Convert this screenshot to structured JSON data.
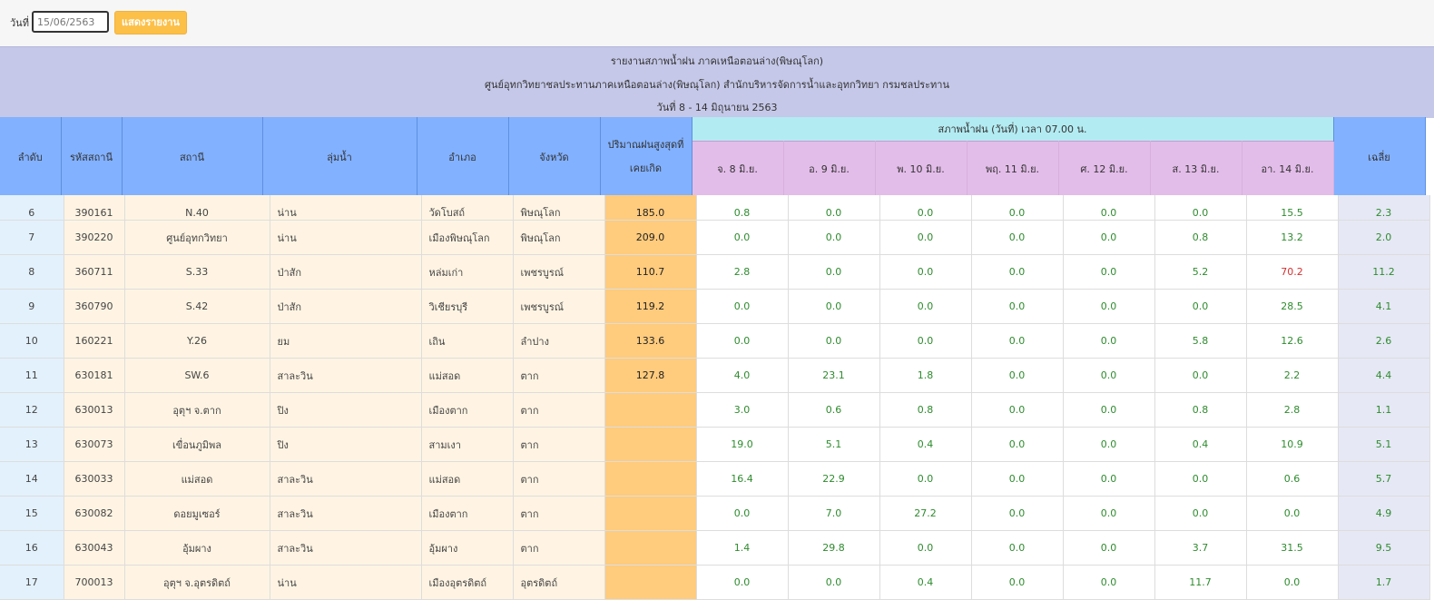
{
  "filter": {
    "date_label": "วันที่",
    "date_value": "15/06/2563",
    "show_button": "แสดงรายงาน"
  },
  "report": {
    "title1": "รายงานสภาพน้ำฝน ภาคเหนือตอนล่าง(พิษณุโลก)",
    "title2": "ศูนย์อุทกวิทยาชลประทานภาคเหนือตอนล่าง(พิษณุโลก) สำนักบริหารจัดการน้ำและอุทกวิทยา กรมชลประทาน",
    "title3": "วันที่ 8 - 14 มิถุนายน 2563"
  },
  "headers": {
    "seq": "ลำดับ",
    "code": "รหัสสถานี",
    "station": "สถานี",
    "basin": "ลุ่มน้ำ",
    "district": "อำเภอ",
    "province": "จังหวัด",
    "max_line1": "ปริมาณฝนสูงสุดที่",
    "max_line2": "เคยเกิด",
    "group": "สภาพน้ำฝน (วันที่) เวลา 07.00 น.",
    "days": [
      "จ. 8 มิ.ย.",
      "อ. 9 มิ.ย.",
      "พ. 10 มิ.ย.",
      "พฤ. 11 มิ.ย.",
      "ศ. 12 มิ.ย.",
      "ส. 13 มิ.ย.",
      "อา. 14 มิ.ย."
    ],
    "avg": "เฉลี่ย"
  },
  "rows": [
    {
      "seq": "6",
      "code": "390161",
      "station": "N.40",
      "basin": "น่าน",
      "district": "วัดโบสถ์",
      "province": "พิษณุโลก",
      "max": "185.0",
      "vals": [
        "0.8",
        "0.0",
        "0.0",
        "0.0",
        "0.0",
        "0.0",
        "15.5"
      ],
      "avg": "2.3",
      "high": -1
    },
    {
      "seq": "7",
      "code": "390220",
      "station": "ศูนย์อุทกวิทยา",
      "basin": "น่าน",
      "district": "เมืองพิษณุโลก",
      "province": "พิษณุโลก",
      "max": "209.0",
      "vals": [
        "0.0",
        "0.0",
        "0.0",
        "0.0",
        "0.0",
        "0.8",
        "13.2"
      ],
      "avg": "2.0",
      "high": -1
    },
    {
      "seq": "8",
      "code": "360711",
      "station": "S.33",
      "basin": "ป่าสัก",
      "district": "หล่มเก่า",
      "province": "เพชรบูรณ์",
      "max": "110.7",
      "vals": [
        "2.8",
        "0.0",
        "0.0",
        "0.0",
        "0.0",
        "5.2",
        "70.2"
      ],
      "avg": "11.2",
      "high": 6
    },
    {
      "seq": "9",
      "code": "360790",
      "station": "S.42",
      "basin": "ป่าสัก",
      "district": "วิเชียรบุรี",
      "province": "เพชรบูรณ์",
      "max": "119.2",
      "vals": [
        "0.0",
        "0.0",
        "0.0",
        "0.0",
        "0.0",
        "0.0",
        "28.5"
      ],
      "avg": "4.1",
      "high": -1
    },
    {
      "seq": "10",
      "code": "160221",
      "station": "Y.26",
      "basin": "ยม",
      "district": "เถิน",
      "province": "ลำปาง",
      "max": "133.6",
      "vals": [
        "0.0",
        "0.0",
        "0.0",
        "0.0",
        "0.0",
        "5.8",
        "12.6"
      ],
      "avg": "2.6",
      "high": -1
    },
    {
      "seq": "11",
      "code": "630181",
      "station": "SW.6",
      "basin": "สาละวิน",
      "district": "แม่สอด",
      "province": "ตาก",
      "max": "127.8",
      "vals": [
        "4.0",
        "23.1",
        "1.8",
        "0.0",
        "0.0",
        "0.0",
        "2.2"
      ],
      "avg": "4.4",
      "high": -1
    },
    {
      "seq": "12",
      "code": "630013",
      "station": "อุตุฯ จ.ตาก",
      "basin": "ปิง",
      "district": "เมืองตาก",
      "province": "ตาก",
      "max": "",
      "vals": [
        "3.0",
        "0.6",
        "0.8",
        "0.0",
        "0.0",
        "0.8",
        "2.8"
      ],
      "avg": "1.1",
      "high": -1
    },
    {
      "seq": "13",
      "code": "630073",
      "station": "เขื่อนภูมิพล",
      "basin": "ปิง",
      "district": "สามเงา",
      "province": "ตาก",
      "max": "",
      "vals": [
        "19.0",
        "5.1",
        "0.4",
        "0.0",
        "0.0",
        "0.4",
        "10.9"
      ],
      "avg": "5.1",
      "high": -1
    },
    {
      "seq": "14",
      "code": "630033",
      "station": "แม่สอด",
      "basin": "สาละวิน",
      "district": "แม่สอด",
      "province": "ตาก",
      "max": "",
      "vals": [
        "16.4",
        "22.9",
        "0.0",
        "0.0",
        "0.0",
        "0.0",
        "0.6"
      ],
      "avg": "5.7",
      "high": -1
    },
    {
      "seq": "15",
      "code": "630082",
      "station": "ดอยมูเซอร์",
      "basin": "สาละวิน",
      "district": "เมืองตาก",
      "province": "ตาก",
      "max": "",
      "vals": [
        "0.0",
        "7.0",
        "27.2",
        "0.0",
        "0.0",
        "0.0",
        "0.0"
      ],
      "avg": "4.9",
      "high": -1
    },
    {
      "seq": "16",
      "code": "630043",
      "station": "อุ้มผาง",
      "basin": "สาละวิน",
      "district": "อุ้มผาง",
      "province": "ตาก",
      "max": "",
      "vals": [
        "1.4",
        "29.8",
        "0.0",
        "0.0",
        "0.0",
        "3.7",
        "31.5"
      ],
      "avg": "9.5",
      "high": -1
    },
    {
      "seq": "17",
      "code": "700013",
      "station": "อุตุฯ จ.อุตรดิตถ์",
      "basin": "น่าน",
      "district": "เมืองอุตรดิตถ์",
      "province": "อุตรดิตถ์",
      "max": "",
      "vals": [
        "0.0",
        "0.0",
        "0.4",
        "0.0",
        "0.0",
        "11.7",
        "0.0"
      ],
      "avg": "1.7",
      "high": -1
    }
  ]
}
